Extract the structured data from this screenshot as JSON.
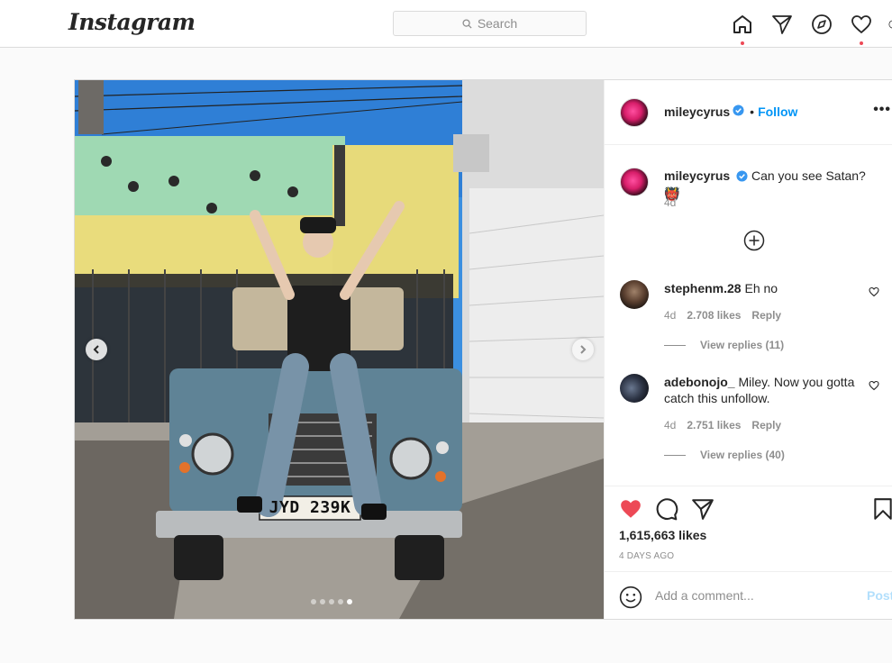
{
  "nav": {
    "logo": "Instagram",
    "search_placeholder": "Search",
    "icons": [
      "home-icon",
      "direct-icon",
      "explore-icon",
      "activity-icon",
      "profile-icon"
    ]
  },
  "post": {
    "author": "mileycyrus",
    "follow_label": "Follow",
    "separator": "•",
    "more_label": "•••",
    "plate": "JYD 239K",
    "caption": {
      "user": "mileycyrus",
      "text": "Can you see Satan?",
      "emoji": "👹",
      "time": "4d"
    },
    "comments": [
      {
        "user": "stephenm.28",
        "text": "Eh no",
        "time": "4d",
        "likes": "2.708 likes",
        "reply": "Reply",
        "view_replies": "View replies (11)"
      },
      {
        "user": "adebonojo_",
        "text": "Miley. Now you gotta catch this unfollow.",
        "time": "4d",
        "likes": "2.751 likes",
        "reply": "Reply",
        "view_replies": "View replies (40)"
      }
    ],
    "likes": "1,615,663 likes",
    "time_ago": "4 DAYS AGO",
    "add_comment_placeholder": "Add a comment...",
    "post_button": "Post",
    "carousel": {
      "count": 5,
      "active_index": 4
    }
  },
  "colors": {
    "accent": "#0095f6",
    "like_red": "#ed4956",
    "post_disabled": "#b2dffc"
  }
}
